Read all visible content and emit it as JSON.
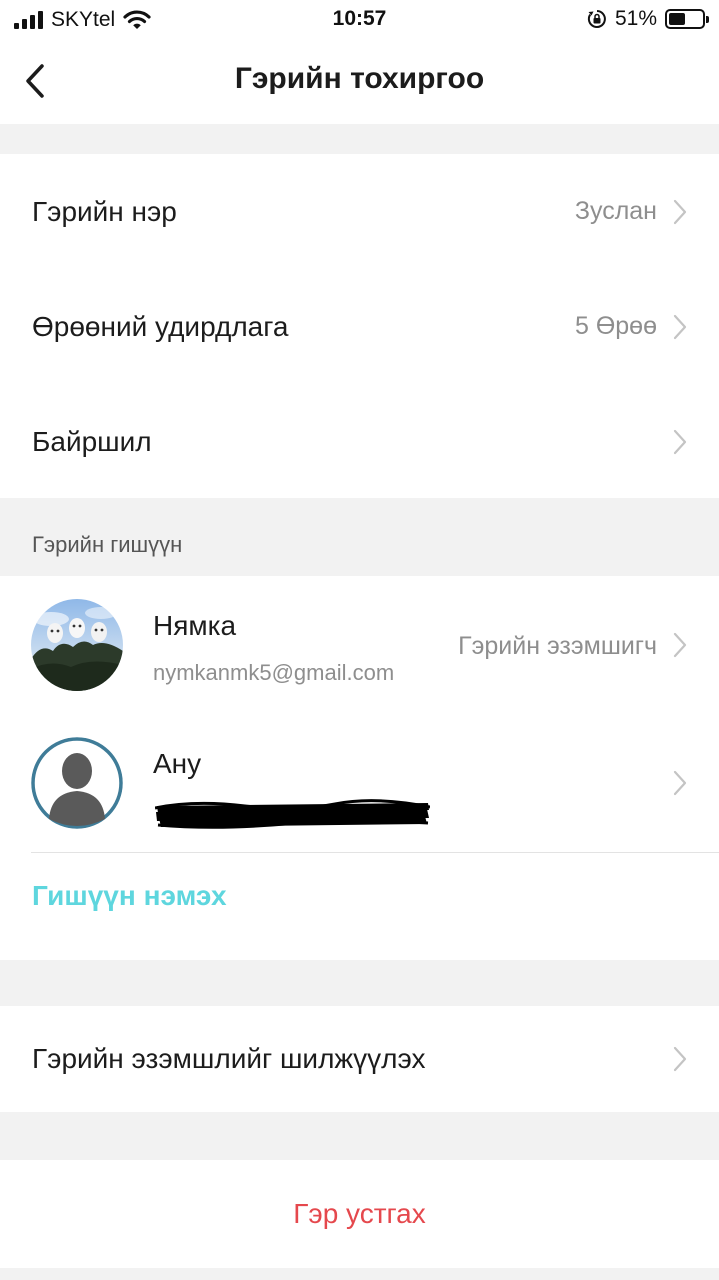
{
  "status_bar": {
    "carrier": "SKYtel",
    "time": "10:57",
    "battery_percent": "51%",
    "battery_level": 0.51
  },
  "header": {
    "title": "Гэрийн тохиргоо",
    "back_icon": "chevron-left-icon"
  },
  "settings": {
    "home_name_label": "Гэрийн нэр",
    "home_name_value": "Зуслан",
    "room_management_label": "Өрөөний удирдлага",
    "room_management_value": "5 Өрөө",
    "location_label": "Байршил"
  },
  "members_section": {
    "title": "Гэрийн гишүүн",
    "members": [
      {
        "name": "Нямка",
        "email": "nymkanmk5@gmail.com",
        "role": "Гэрийн эзэмшигч",
        "avatar": "photo-avatar"
      },
      {
        "name": "Ану",
        "email": "",
        "role": "",
        "avatar": "default-person-avatar"
      }
    ],
    "add_member_label": "Гишүүн нэмэх"
  },
  "transfer_ownership_label": "Гэрийн эзэмшлийг шилжүүлэх",
  "delete_home_label": "Гэр устгах",
  "colors": {
    "accent": "#5ed6de",
    "danger": "#e5484d",
    "secondary_text": "#8e8e8e",
    "background": "#f2f2f2"
  }
}
